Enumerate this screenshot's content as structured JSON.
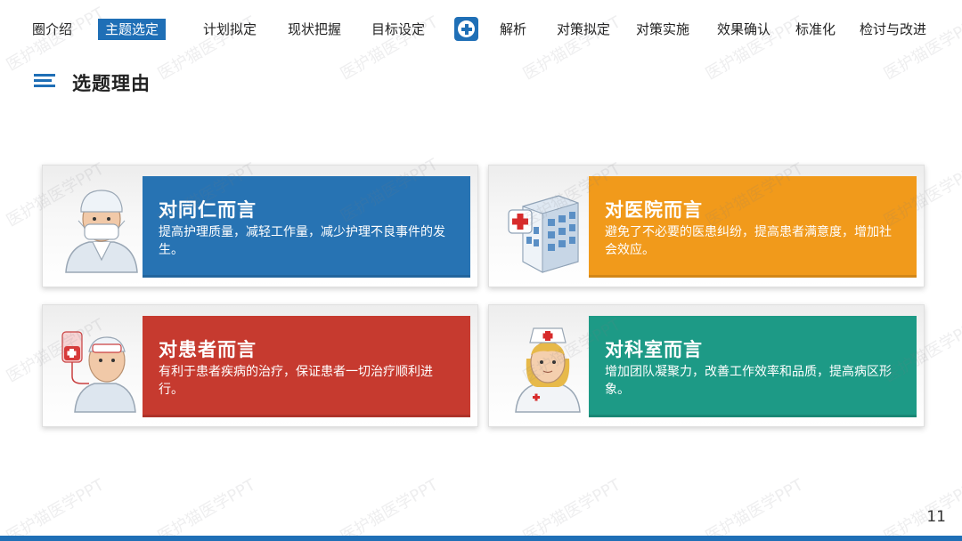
{
  "nav": {
    "items": [
      "圈介绍",
      "主题选定",
      "计划拟定",
      "现状把握",
      "目标设定",
      "解析",
      "对策拟定",
      "对策实施",
      "效果确认",
      "标准化",
      "检讨与改进"
    ],
    "active_index": 1,
    "plus_icon": "plus-circle-icon"
  },
  "section": {
    "title": "选题理由",
    "icon": "menu-lines-icon"
  },
  "cards": [
    {
      "title": "对同仁而言",
      "body": "提高护理质量，减轻工作量，减少护理不良事件的发生。",
      "color": "#2773b3",
      "icon": "nurse-with-mask-icon"
    },
    {
      "title": "对医院而言",
      "body": "避免了不必要的医患纠纷，提高患者满意度，增加社会效应。",
      "color": "#f19a1b",
      "icon": "hospital-building-icon"
    },
    {
      "title": "对患者而言",
      "body": "有利于患者疾病的治疗，保证患者一切治疗顺利进行。",
      "color": "#c63a2f",
      "icon": "patient-with-iv-icon"
    },
    {
      "title": "对科室而言",
      "body": "增加团队凝聚力，改善工作效率和品质，提高病区形象。",
      "color": "#1d9a86",
      "icon": "nurse-with-cap-icon"
    }
  ],
  "page_number": "11",
  "watermark": "医护猫医学PPT",
  "colors": {
    "accent": "#1f6fb6"
  }
}
